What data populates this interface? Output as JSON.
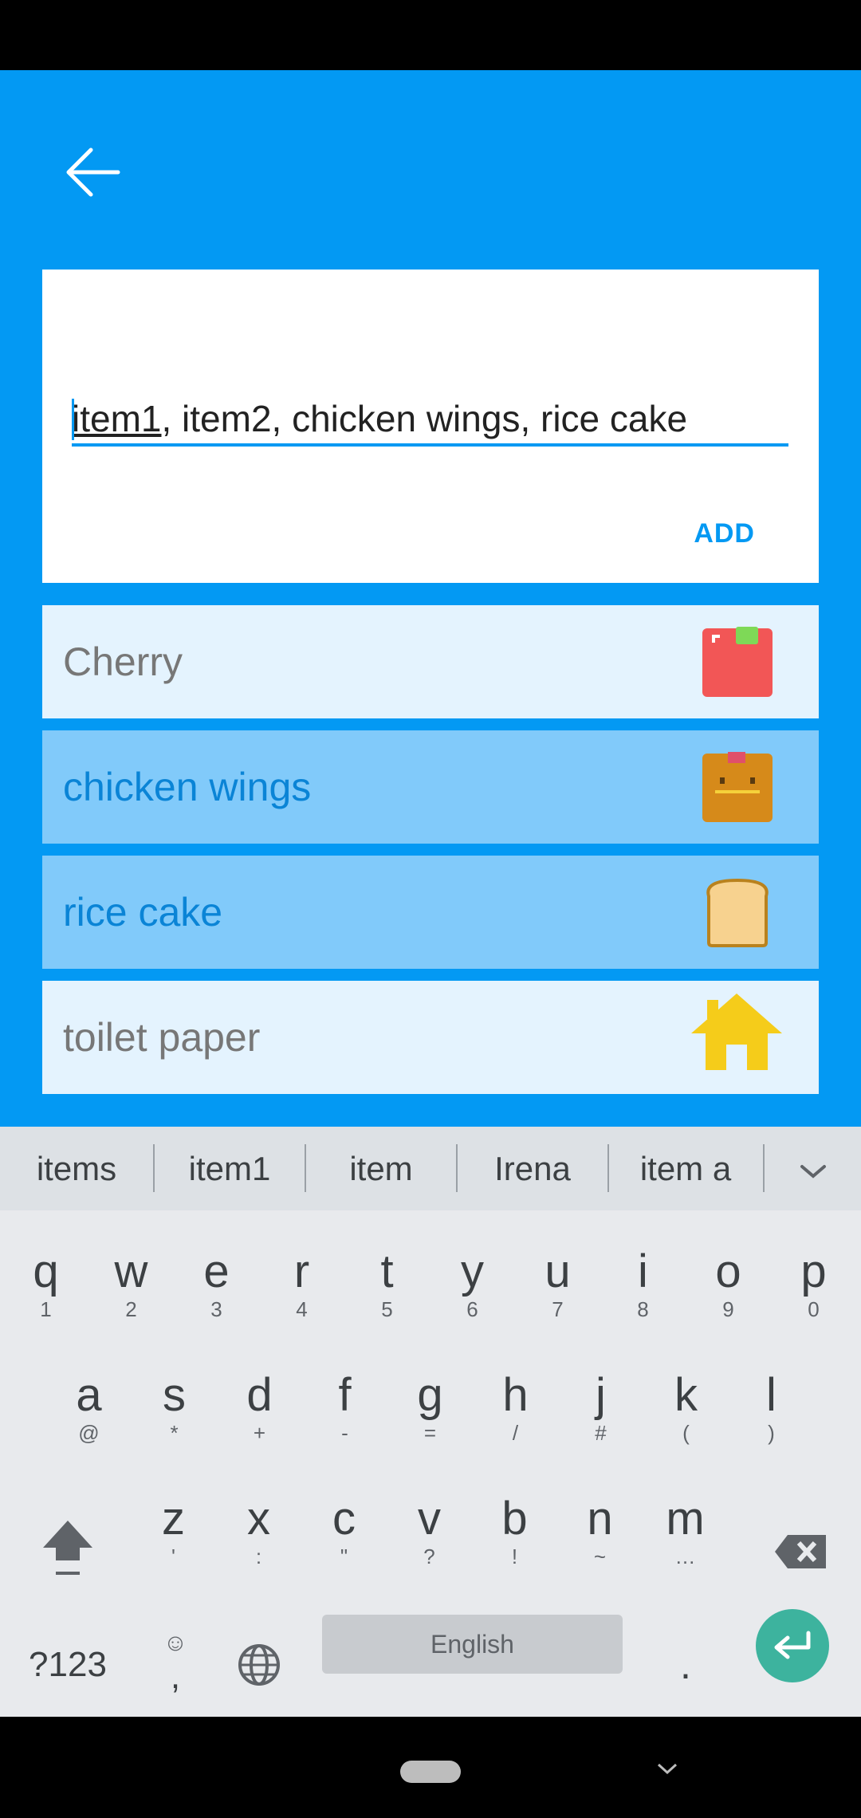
{
  "app": {
    "input_value_underlined": "item1",
    "input_value_rest": ", item2, chicken wings, rice cake",
    "add_label": "ADD",
    "items": [
      {
        "label": "Cherry",
        "icon": "cherry-icon",
        "style": "light"
      },
      {
        "label": "chicken wings",
        "icon": "chicken-wings-icon",
        "style": "dark"
      },
      {
        "label": "rice cake",
        "icon": "bread-icon",
        "style": "dark"
      },
      {
        "label": "toilet paper",
        "icon": "house-icon",
        "style": "light"
      }
    ]
  },
  "keyboard": {
    "suggestions": [
      "items",
      "item1",
      "item",
      "Irena",
      "item a"
    ],
    "row1": [
      {
        "m": "q",
        "s": "1"
      },
      {
        "m": "w",
        "s": "2"
      },
      {
        "m": "e",
        "s": "3"
      },
      {
        "m": "r",
        "s": "4"
      },
      {
        "m": "t",
        "s": "5"
      },
      {
        "m": "y",
        "s": "6"
      },
      {
        "m": "u",
        "s": "7"
      },
      {
        "m": "i",
        "s": "8"
      },
      {
        "m": "o",
        "s": "9"
      },
      {
        "m": "p",
        "s": "0"
      }
    ],
    "row2": [
      {
        "m": "a",
        "s": "@"
      },
      {
        "m": "s",
        "s": "*"
      },
      {
        "m": "d",
        "s": "+"
      },
      {
        "m": "f",
        "s": "-"
      },
      {
        "m": "g",
        "s": "="
      },
      {
        "m": "h",
        "s": "/"
      },
      {
        "m": "j",
        "s": "#"
      },
      {
        "m": "k",
        "s": "("
      },
      {
        "m": "l",
        "s": ")"
      }
    ],
    "row3": [
      {
        "m": "z",
        "s": "'"
      },
      {
        "m": "x",
        "s": ":"
      },
      {
        "m": "c",
        "s": "\""
      },
      {
        "m": "v",
        "s": "?"
      },
      {
        "m": "b",
        "s": "!"
      },
      {
        "m": "n",
        "s": "~"
      },
      {
        "m": "m",
        "s": "…"
      }
    ],
    "symbols_label": "?123",
    "comma_label": ",",
    "space_label": "English",
    "period_label": "."
  },
  "colors": {
    "accent": "#0399F3",
    "enter_key": "#3DB39E"
  }
}
